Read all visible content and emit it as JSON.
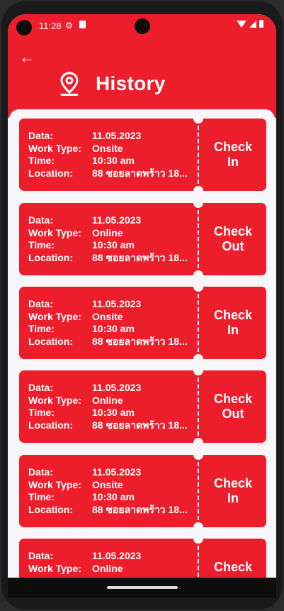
{
  "status": {
    "time": "11:28"
  },
  "header": {
    "title": "History"
  },
  "labels": {
    "date": "Data:",
    "work_type": "Work Type:",
    "time": "Time:",
    "location": "Location:"
  },
  "items": [
    {
      "date": "11.05.2023",
      "work_type": "Onsite",
      "time": "10:30 am",
      "location": "88 ซอยลาดพร้าว 18...",
      "action_line1": "Check",
      "action_line2": "In"
    },
    {
      "date": "11.05.2023",
      "work_type": "Online",
      "time": "10:30 am",
      "location": "88 ซอยลาดพร้าว 18...",
      "action_line1": "Check",
      "action_line2": "Out"
    },
    {
      "date": "11.05.2023",
      "work_type": "Onsite",
      "time": "10:30 am",
      "location": "88 ซอยลาดพร้าว 18...",
      "action_line1": "Check",
      "action_line2": "In"
    },
    {
      "date": "11.05.2023",
      "work_type": "Online",
      "time": "10:30 am",
      "location": "88 ซอยลาดพร้าว 18...",
      "action_line1": "Check",
      "action_line2": "Out"
    },
    {
      "date": "11.05.2023",
      "work_type": "Onsite",
      "time": "10:30 am",
      "location": "88 ซอยลาดพร้าว 18...",
      "action_line1": "Check",
      "action_line2": "In"
    },
    {
      "date": "11.05.2023",
      "work_type": "Online",
      "time": "",
      "location": "",
      "action_line1": "Check",
      "action_line2": ""
    }
  ],
  "icons": {
    "back": "arrow-left-icon",
    "title": "location-pin-icon"
  },
  "colors": {
    "primary": "#ec1e2b",
    "background": "#f7f7f9"
  }
}
